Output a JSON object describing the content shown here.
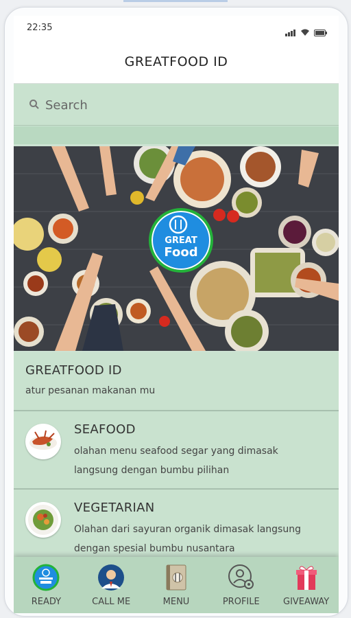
{
  "status": {
    "time": "22:35"
  },
  "appbar": {
    "title": "GREATFOOD ID"
  },
  "search": {
    "placeholder": "Search"
  },
  "banner": {
    "logo_line1": "GREAT",
    "logo_line2": "Food"
  },
  "info": {
    "title": "GREATFOOD ID",
    "subtitle": "atur pesanan makanan mu"
  },
  "categories": [
    {
      "title": "SEAFOOD",
      "description": "olahan menu seafood segar yang dimasak langsung dengan bumbu pilihan"
    },
    {
      "title": "VEGETARIAN",
      "description": "Olahan dari sayuran organik dimasak langsung dengan spesial bumbu nusantara"
    }
  ],
  "nav": [
    {
      "label": "READY",
      "icon": "greatfood-logo-icon"
    },
    {
      "label": "CALL ME",
      "icon": "waiter-icon"
    },
    {
      "label": "MENU",
      "icon": "menu-book-icon"
    },
    {
      "label": "PROFILE",
      "icon": "profile-icon"
    },
    {
      "label": "GIVEAWAY",
      "icon": "gift-icon"
    }
  ],
  "colors": {
    "accent_green": "#24b33a",
    "logo_blue": "#1f8de0",
    "surface": "#c9e2cf"
  }
}
